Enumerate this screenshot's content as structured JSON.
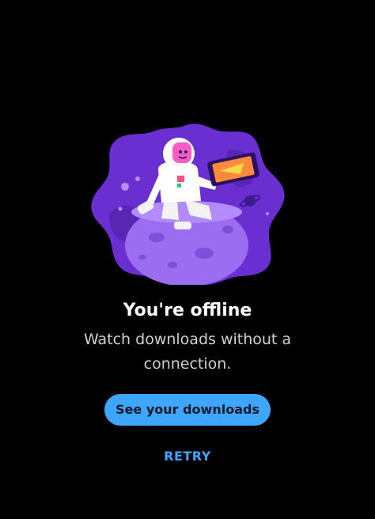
{
  "offline": {
    "illustration_icon": "astronaut-on-planet-illustration",
    "title": "You're offline",
    "subtitle": "Watch downloads without a connection.",
    "primary_action_label": "See your downloads",
    "retry_label": "RETRY"
  },
  "colors": {
    "background": "#000000",
    "accent": "#3ea6ff",
    "illustration_purple": "#6a2fd0"
  }
}
